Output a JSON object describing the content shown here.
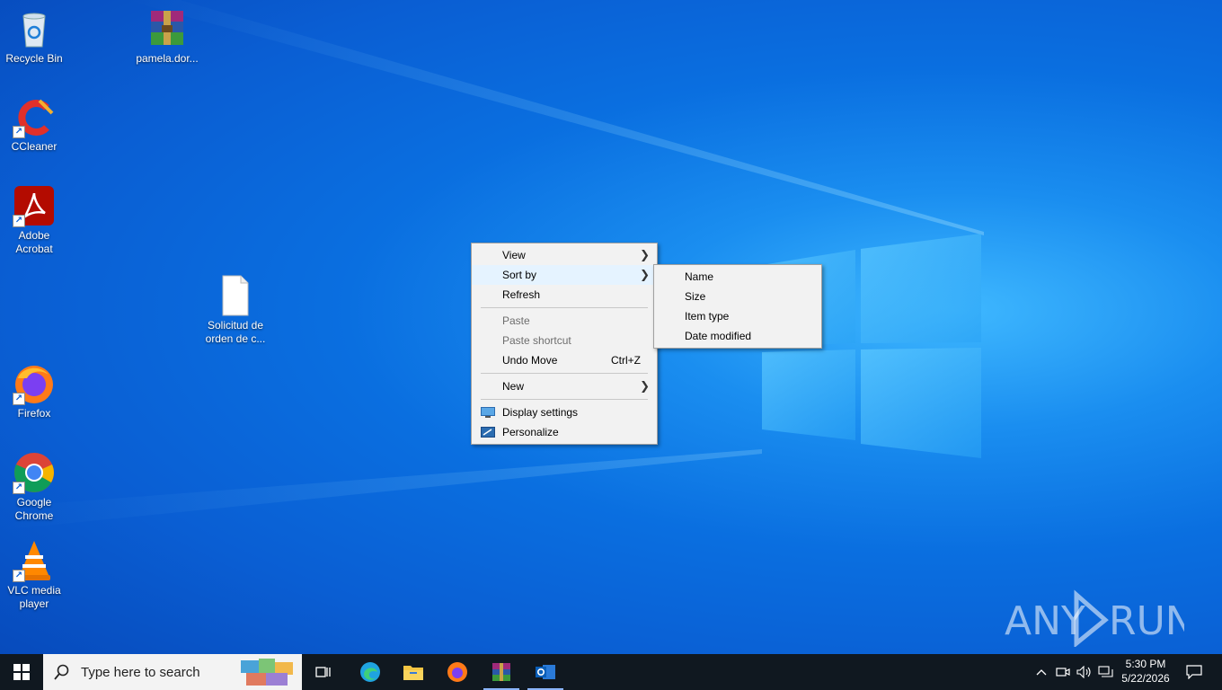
{
  "desktop": {
    "icons": [
      {
        "label": "Recycle Bin",
        "icon": "recycle-bin-icon"
      },
      {
        "label": "pamela.dor...",
        "icon": "winrar-archive-icon"
      },
      {
        "label": "CCleaner",
        "icon": "ccleaner-icon"
      },
      {
        "label": "Adobe Acrobat",
        "icon": "adobe-acrobat-icon"
      },
      {
        "label": "Solicitud de orden de c...",
        "icon": "document-file-icon"
      },
      {
        "label": "Firefox",
        "icon": "firefox-icon"
      },
      {
        "label": "Google Chrome",
        "icon": "chrome-icon"
      },
      {
        "label": "VLC media player",
        "icon": "vlc-icon"
      }
    ]
  },
  "context_menu": {
    "items": [
      {
        "label": "View",
        "submenu": true
      },
      {
        "label": "Sort by",
        "submenu": true,
        "highlighted": true
      },
      {
        "label": "Refresh"
      },
      {
        "label": "Paste",
        "disabled": true
      },
      {
        "label": "Paste shortcut",
        "disabled": true
      },
      {
        "label": "Undo Move",
        "shortcut": "Ctrl+Z"
      },
      {
        "label": "New",
        "submenu": true
      },
      {
        "label": "Display settings",
        "icon": "display-settings-icon"
      },
      {
        "label": "Personalize",
        "icon": "personalize-icon"
      }
    ]
  },
  "sort_submenu": {
    "items": [
      {
        "label": "Name"
      },
      {
        "label": "Size"
      },
      {
        "label": "Item type"
      },
      {
        "label": "Date modified"
      }
    ]
  },
  "taskbar": {
    "search_placeholder": "Type here to search",
    "apps": [
      "task-view-icon",
      "edge-icon",
      "file-explorer-icon",
      "firefox-icon",
      "winrar-icon",
      "outlook-icon"
    ],
    "clock": {
      "time": "5:30 PM",
      "date": "5/22/2026"
    }
  },
  "watermark": {
    "text": "ANY RUN"
  },
  "colors": {
    "accent": "#0a6fe0",
    "taskbar": "#101820",
    "menu_bg": "#f2f2f2",
    "highlight": "#e5f3ff"
  }
}
